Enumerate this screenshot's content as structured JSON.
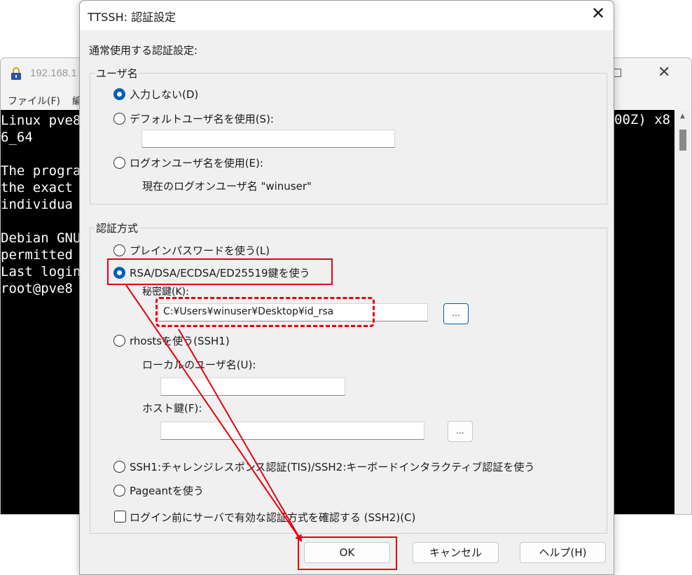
{
  "terminal": {
    "title": "192.168.1",
    "close_glyph": "✕",
    "menu": [
      "ファイル(F)",
      "編"
    ],
    "lines": [
      "Linux pve8",
      "6_64",
      "",
      "The progra",
      "the exact",
      "individua",
      "",
      "Debian GNU",
      "permitted",
      "Last login",
      "root@pve8"
    ],
    "right_text": "00Z) x8"
  },
  "dialog": {
    "title": "TTSSH: 認証設定",
    "close_glyph": "✕",
    "heading": "通常使用する認証設定:",
    "username_group": {
      "legend": "ユーザ名",
      "options": [
        {
          "label": "入力しない(D)",
          "checked": true
        },
        {
          "label": "デフォルトユーザ名を使用(S):",
          "checked": false
        },
        {
          "label": "ログオンユーザ名を使用(E):",
          "checked": false
        }
      ],
      "default_username_value": "",
      "current_logon_user": "現在のログオンユーザ名 \"winuser\""
    },
    "auth_group": {
      "legend": "認証方式",
      "options": [
        {
          "label": "プレインパスワードを使う(L)",
          "checked": false
        },
        {
          "label": "RSA/DSA/ECDSA/ED25519鍵を使う",
          "checked": true
        },
        {
          "label": "rhostsを使う(SSH1)",
          "checked": false
        },
        {
          "label": "SSH1:チャレンジレスポンス認証(TIS)/SSH2:キーボードインタラクティブ認証を使う",
          "checked": false
        },
        {
          "label": "Pageantを使う",
          "checked": false
        }
      ],
      "private_key_label": "秘密鍵(K):",
      "private_key_value": "C:¥Users¥winuser¥Desktop¥id_rsa",
      "local_user_label": "ローカルのユーザ名(U):",
      "local_user_value": "",
      "host_key_label": "ホスト鍵(F):",
      "host_key_value": "",
      "browse_label": "..."
    },
    "confirm_checkbox": {
      "label": "ログイン前にサーバで有効な認証方式を確認する (SSH2)(C)",
      "checked": false
    },
    "buttons": {
      "ok": "OK",
      "cancel": "キャンセル",
      "help": "ヘルプ(H)"
    }
  },
  "annotation_color": "#e60012",
  "accent_color": "#005fb8"
}
